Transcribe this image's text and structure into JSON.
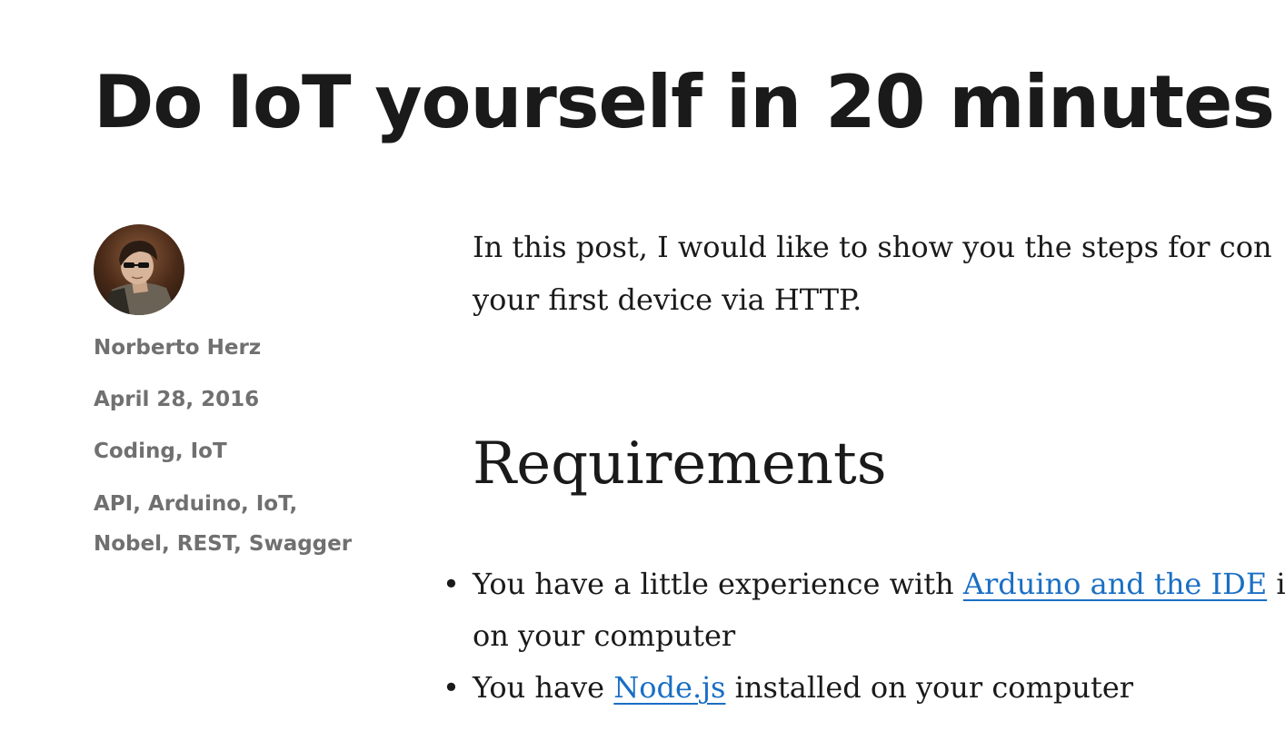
{
  "post": {
    "title": "Do IoT yourself in 20 minutes"
  },
  "meta": {
    "author": "Norberto Herz",
    "date": "April 28, 2016",
    "categories": "Coding, IoT",
    "tags_line1": "API, Arduino, IoT,",
    "tags_line2": "Nobel, REST, Swagger"
  },
  "content": {
    "intro_line1": "In this post, I would like to show you the steps for con",
    "intro_line2": "your first device via HTTP.",
    "requirements_heading": "Requirements",
    "bullet_char": "•",
    "items": [
      {
        "before": "You have a little experience with ",
        "link": "Arduino and the IDE",
        "after": " i",
        "line2": "on your computer"
      },
      {
        "before": "You have ",
        "link": "Node.js",
        "after": " installed on your computer"
      }
    ]
  },
  "colors": {
    "text": "#1a1a1a",
    "meta_text": "#707070",
    "link": "#1a6fc4",
    "background": "#ffffff"
  },
  "icons": {
    "avatar": "author-avatar-photo"
  }
}
